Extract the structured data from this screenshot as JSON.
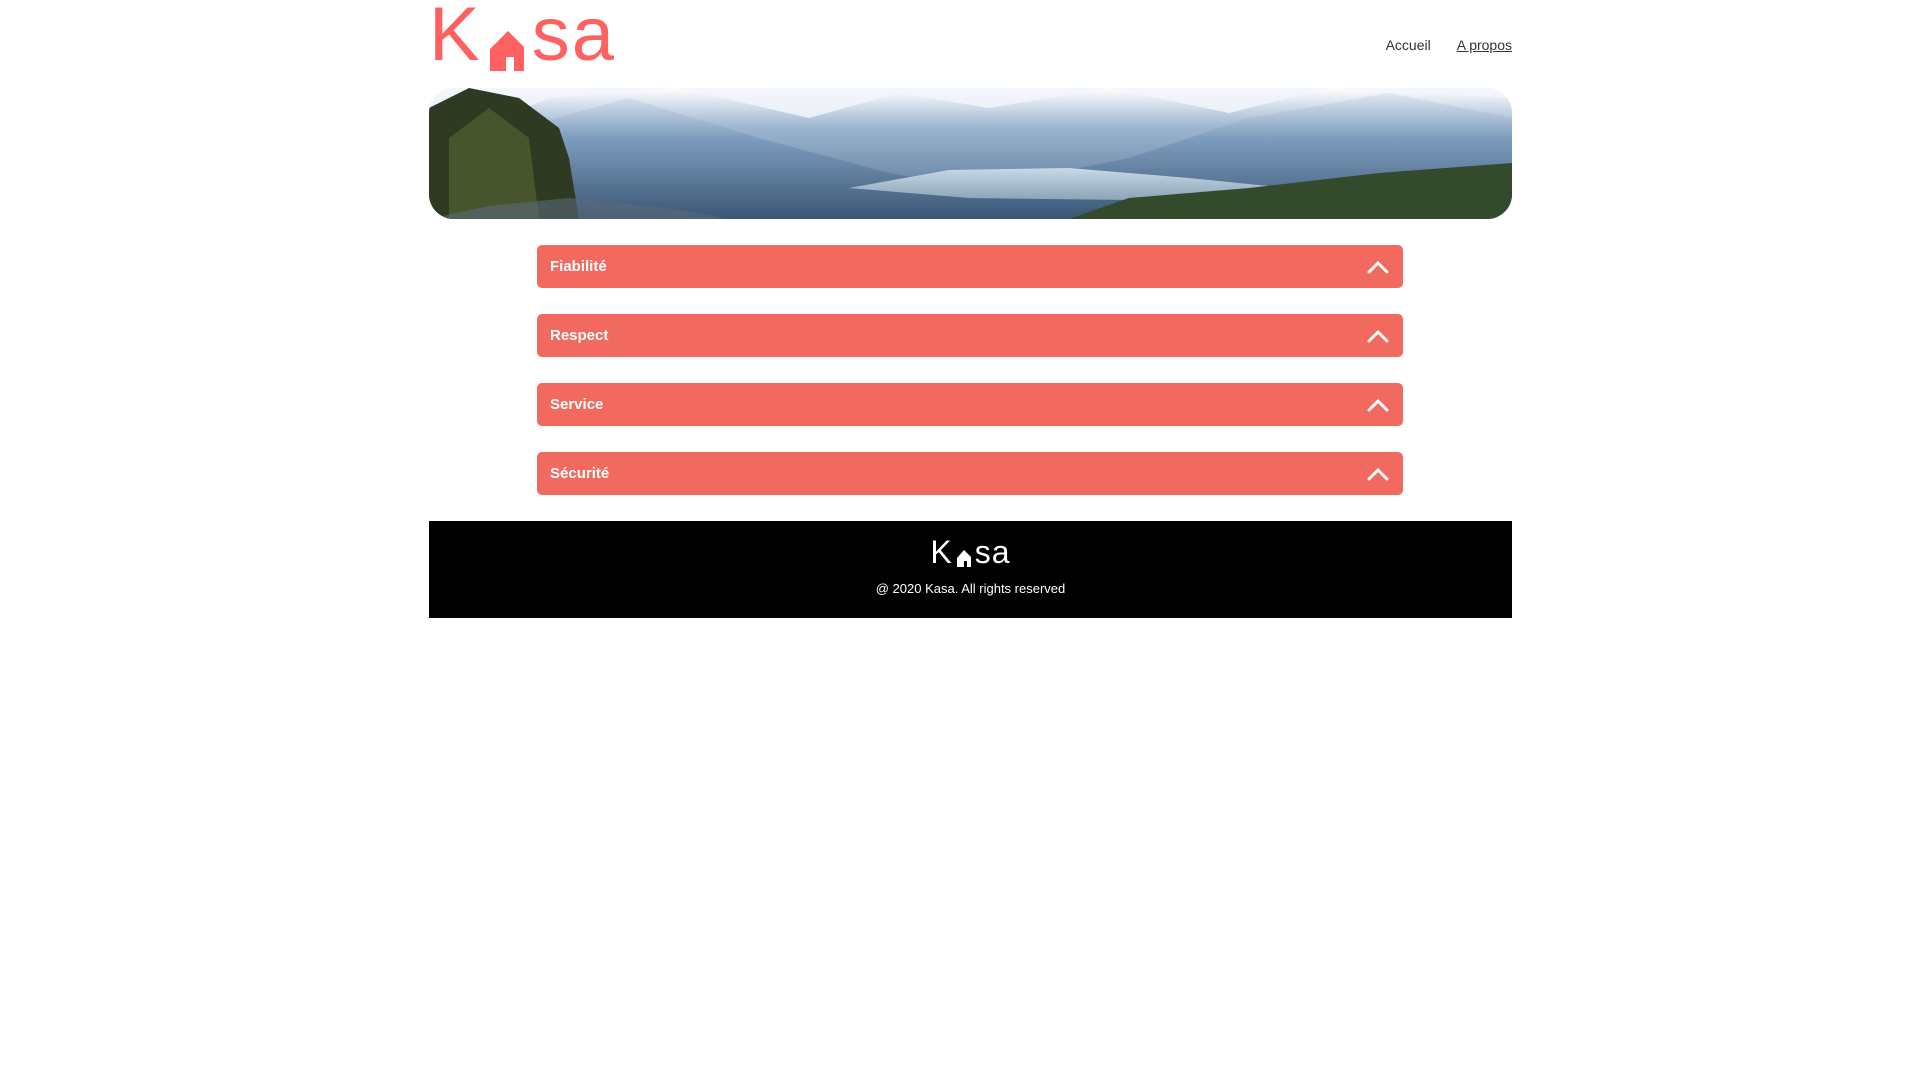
{
  "brand": {
    "name": "Kasa",
    "color": "#FF6060"
  },
  "nav": {
    "home_label": "Accueil",
    "about_label": "A propos"
  },
  "banner": {
    "image": "mountain-landscape"
  },
  "accordion": {
    "color": "#F2695F",
    "items": [
      {
        "label": "Fiabilité",
        "icon": "chevron-up-icon"
      },
      {
        "label": "Respect",
        "icon": "chevron-up-icon"
      },
      {
        "label": "Service",
        "icon": "chevron-up-icon"
      },
      {
        "label": "Sécurité",
        "icon": "chevron-up-icon"
      }
    ]
  },
  "footer": {
    "copyright": "@ 2020 Kasa. All rights reserved"
  }
}
